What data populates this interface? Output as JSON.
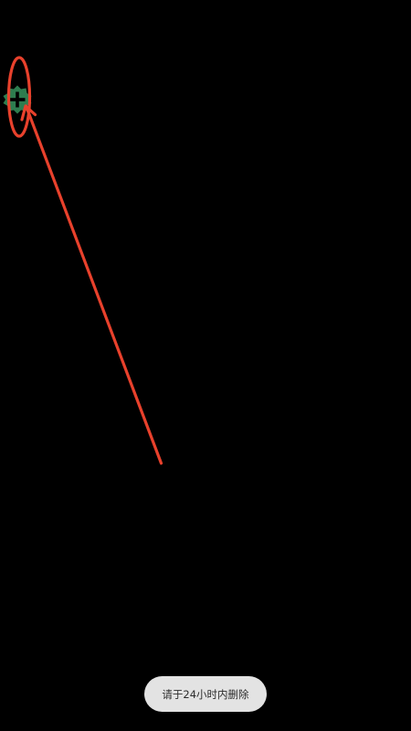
{
  "screen": {
    "background": "#000000"
  },
  "add_button": {
    "icon": "add-badge-icon",
    "color": "#2e7d4f",
    "glyph_color": "#000000"
  },
  "annotation": {
    "color": "#e8412c",
    "shapes": [
      "highlight-ellipse",
      "pointer-arrow"
    ]
  },
  "toast": {
    "message": "请于24小时内删除",
    "background": "#e3e3e3",
    "text_color": "#2c2c2c"
  }
}
